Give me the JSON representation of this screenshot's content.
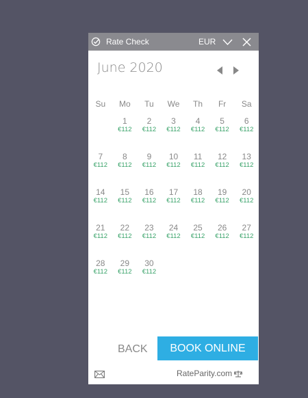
{
  "header": {
    "title": "Rate Check",
    "currency": "EUR"
  },
  "calendar": {
    "month_label": "June 2020",
    "weekdays": [
      "Su",
      "Mo",
      "Tu",
      "We",
      "Th",
      "Fr",
      "Sa"
    ],
    "first_weekday_index": 1,
    "days": [
      {
        "day": "1",
        "price": "€112"
      },
      {
        "day": "2",
        "price": "€112"
      },
      {
        "day": "3",
        "price": "€112"
      },
      {
        "day": "4",
        "price": "€112"
      },
      {
        "day": "5",
        "price": "€112"
      },
      {
        "day": "6",
        "price": "€112"
      },
      {
        "day": "7",
        "price": "€112"
      },
      {
        "day": "8",
        "price": "€112"
      },
      {
        "day": "9",
        "price": "€112"
      },
      {
        "day": "10",
        "price": "€112"
      },
      {
        "day": "11",
        "price": "€112"
      },
      {
        "day": "12",
        "price": "€112"
      },
      {
        "day": "13",
        "price": "€112"
      },
      {
        "day": "14",
        "price": "€112"
      },
      {
        "day": "15",
        "price": "€112"
      },
      {
        "day": "16",
        "price": "€112"
      },
      {
        "day": "17",
        "price": "€112"
      },
      {
        "day": "18",
        "price": "€112"
      },
      {
        "day": "19",
        "price": "€112"
      },
      {
        "day": "20",
        "price": "€112"
      },
      {
        "day": "21",
        "price": "€112"
      },
      {
        "day": "22",
        "price": "€112"
      },
      {
        "day": "23",
        "price": "€112"
      },
      {
        "day": "24",
        "price": "€112"
      },
      {
        "day": "25",
        "price": "€112"
      },
      {
        "day": "26",
        "price": "€112"
      },
      {
        "day": "27",
        "price": "€112"
      },
      {
        "day": "28",
        "price": "€112"
      },
      {
        "day": "29",
        "price": "€112"
      },
      {
        "day": "30",
        "price": "€112"
      }
    ]
  },
  "footer": {
    "back_label": "BACK",
    "book_label": "BOOK ONLINE",
    "brand": "RateParity.com"
  },
  "colors": {
    "background": "#545465",
    "header": "#8a8a8f",
    "accent": "#2eaee3",
    "price": "#3aa36a"
  }
}
